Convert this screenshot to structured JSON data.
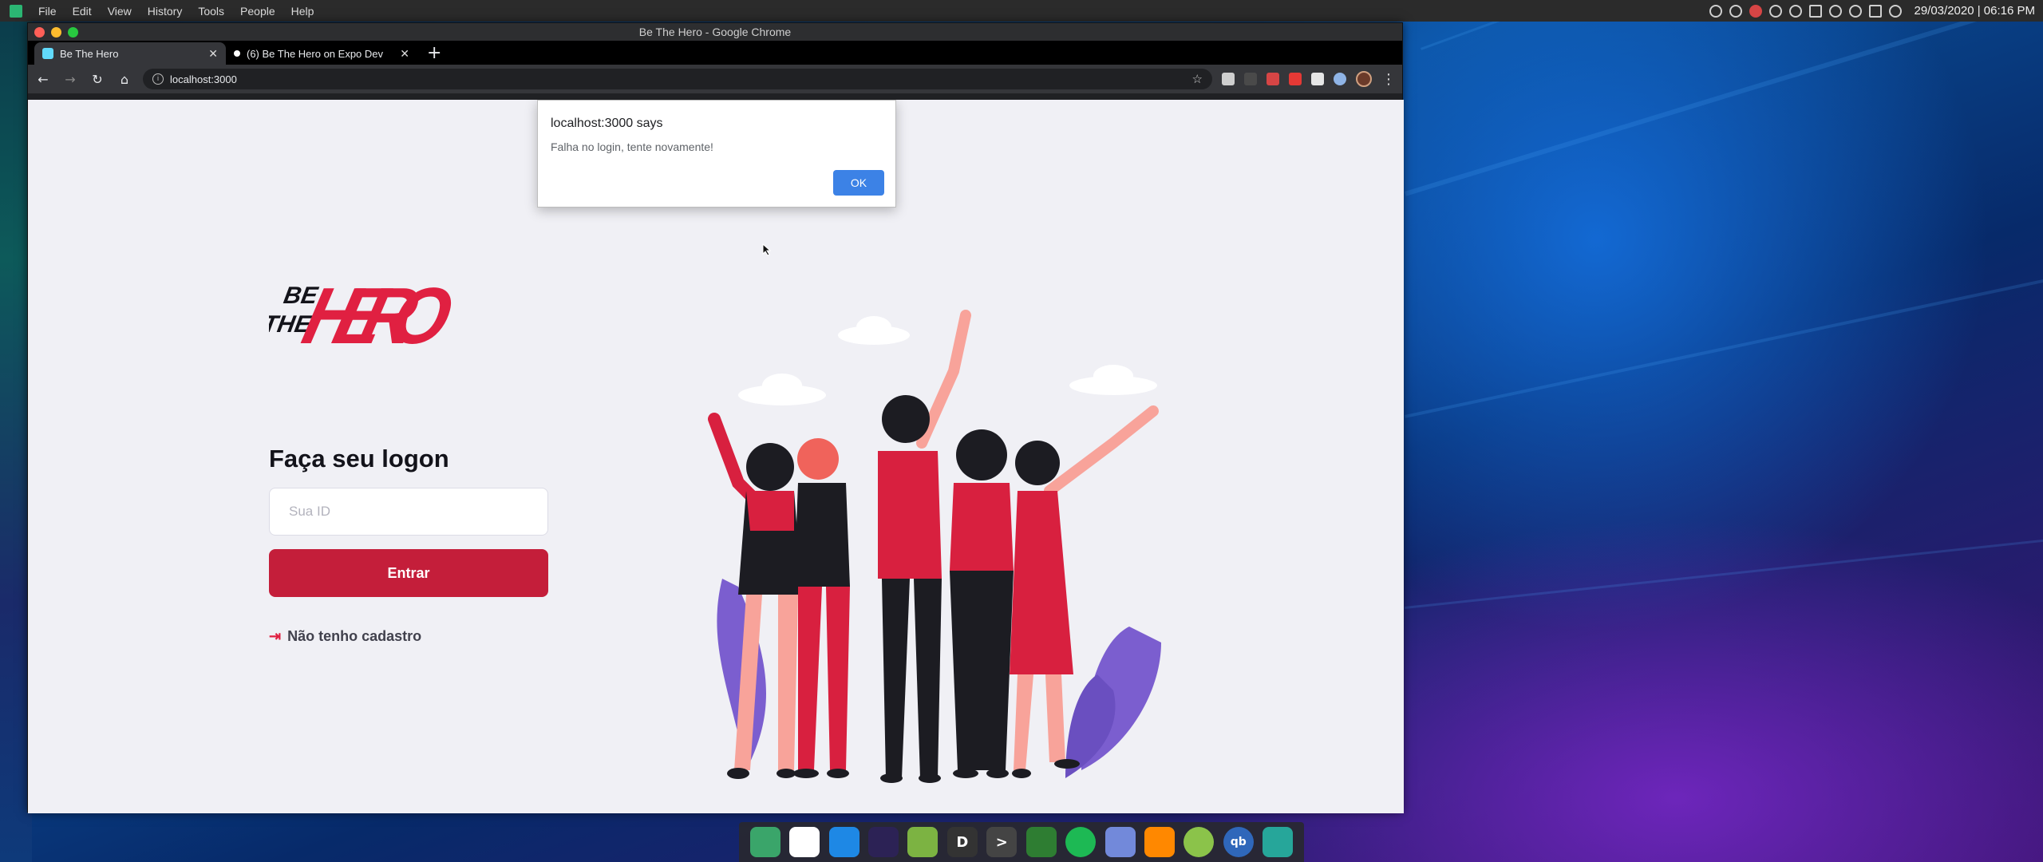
{
  "top_panel": {
    "menu": [
      "File",
      "Edit",
      "View",
      "History",
      "Tools",
      "People",
      "Help"
    ],
    "clock": "29/03/2020 | 06:16 PM"
  },
  "window": {
    "title": "Be The Hero - Google Chrome",
    "tabs": [
      {
        "label": "Be The Hero",
        "active": true
      },
      {
        "label": "(6) Be The Hero on Expo Dev",
        "active": false
      }
    ],
    "url": "localhost:3000"
  },
  "page": {
    "logo_text": "BE THE HERO",
    "heading": "Faça seu logon",
    "id_placeholder": "Sua ID",
    "submit_label": "Entrar",
    "register_link": "Não tenho cadastro"
  },
  "alert": {
    "origin": "localhost:3000 says",
    "message": "Falha no login, tente novamente!",
    "ok_label": "OK"
  },
  "dock": {
    "apps": [
      {
        "name": "files",
        "glyph": ""
      },
      {
        "name": "chrome",
        "glyph": ""
      },
      {
        "name": "vscode",
        "glyph": ""
      },
      {
        "name": "eclipse",
        "glyph": ""
      },
      {
        "name": "android-studio",
        "glyph": ""
      },
      {
        "name": "deepin-app",
        "glyph": "D"
      },
      {
        "name": "terminal",
        "glyph": ">"
      },
      {
        "name": "screen-recorder",
        "glyph": ""
      },
      {
        "name": "spotify",
        "glyph": ""
      },
      {
        "name": "discord",
        "glyph": ""
      },
      {
        "name": "vlc",
        "glyph": ""
      },
      {
        "name": "downloader",
        "glyph": ""
      },
      {
        "name": "qbittorrent",
        "glyph": "qb"
      },
      {
        "name": "notes",
        "glyph": ""
      }
    ]
  },
  "colors": {
    "brand_red": "#e02041",
    "button_red": "#c41e3a",
    "page_bg": "#f0f0f5",
    "alert_ok": "#3c82e6"
  }
}
